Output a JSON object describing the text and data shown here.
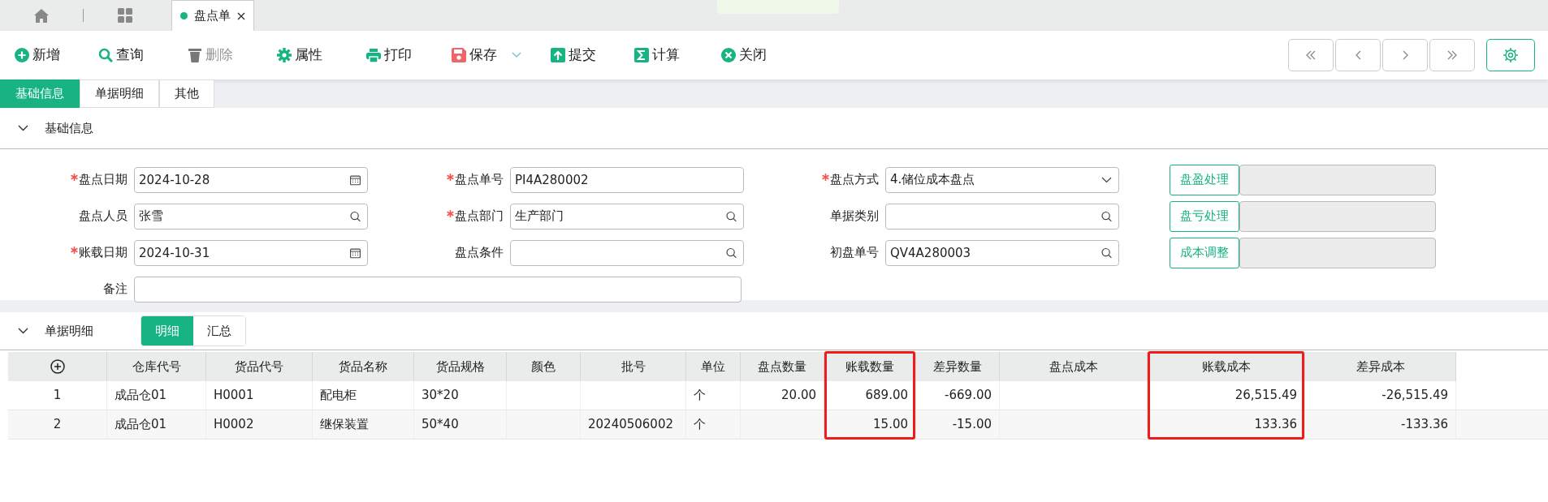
{
  "doc_tabs": [
    {
      "label": "盘点单",
      "selected": true
    }
  ],
  "toolbar": [
    {
      "label": "新增",
      "kind": "plus",
      "disabled": false,
      "dropdown": false
    },
    {
      "label": "查询",
      "kind": "search",
      "disabled": false,
      "dropdown": false
    },
    {
      "label": "删除",
      "kind": "trash",
      "disabled": true,
      "dropdown": false
    },
    {
      "label": "属性",
      "kind": "gear",
      "disabled": false,
      "dropdown": false
    },
    {
      "label": "打印",
      "kind": "print",
      "disabled": false,
      "dropdown": false
    },
    {
      "label": "保存",
      "kind": "save",
      "disabled": false,
      "dropdown": true
    },
    {
      "label": "提交",
      "kind": "submit",
      "disabled": false,
      "dropdown": false
    },
    {
      "label": "计算",
      "kind": "sigma",
      "disabled": false,
      "dropdown": false
    },
    {
      "label": "关闭",
      "kind": "close",
      "disabled": false,
      "dropdown": false
    }
  ],
  "nav_buttons": [
    {
      "kind": "first"
    },
    {
      "kind": "prev"
    },
    {
      "kind": "next"
    },
    {
      "kind": "last"
    }
  ],
  "section_tabs": [
    {
      "label": "基础信息",
      "selected": true
    },
    {
      "label": "单据明细",
      "selected": false
    },
    {
      "label": "其他",
      "selected": false
    }
  ],
  "basic_section": {
    "title": "基础信息",
    "expanded": true,
    "rows": [
      [
        {
          "label": "盘点日期",
          "required": true,
          "kind": "date",
          "value": "2024-10-28"
        },
        {
          "label": "盘点单号",
          "required": true,
          "kind": "text",
          "value": "PI4A280002"
        },
        {
          "label": "盘点方式",
          "required": true,
          "kind": "select",
          "value": "4.储位成本盘点"
        }
      ],
      [
        {
          "label": "盘点人员",
          "required": false,
          "kind": "lookup",
          "value": "张雪"
        },
        {
          "label": "盘点部门",
          "required": true,
          "kind": "lookup",
          "value": "生产部门"
        },
        {
          "label": "单据类别",
          "required": false,
          "kind": "lookup"
        }
      ],
      [
        {
          "label": "账载日期",
          "required": true,
          "kind": "date",
          "value": "2024-10-31"
        },
        {
          "label": "盘点条件",
          "required": false,
          "kind": "lookup"
        },
        {
          "label": "初盘单号",
          "required": false,
          "kind": "lookup",
          "value": "QV4A280003"
        }
      ],
      [
        {
          "label": "备注",
          "required": false,
          "kind": "text"
        }
      ]
    ],
    "actions": [
      {
        "label": "盘盈处理"
      },
      {
        "label": "盘亏处理"
      },
      {
        "label": "成本调整"
      }
    ]
  },
  "detail_section": {
    "title": "单据明细",
    "expanded": true,
    "views": [
      {
        "label": "明细",
        "selected": true
      },
      {
        "label": "汇总",
        "selected": false
      }
    ],
    "table": {
      "columns": [
        {
          "kind": "add",
          "highlighted": false
        },
        {
          "label": "仓库代号",
          "kind": "text",
          "highlighted": false
        },
        {
          "label": "货品代号",
          "kind": "text",
          "highlighted": false
        },
        {
          "label": "货品名称",
          "kind": "text",
          "highlighted": false
        },
        {
          "label": "货品规格",
          "kind": "text",
          "highlighted": false
        },
        {
          "label": "颜色",
          "kind": "text",
          "highlighted": false
        },
        {
          "label": "批号",
          "kind": "text",
          "highlighted": false
        },
        {
          "label": "单位",
          "kind": "text",
          "highlighted": false
        },
        {
          "label": "盘点数量",
          "kind": "number",
          "highlighted": false
        },
        {
          "label": "账载数量",
          "kind": "number",
          "highlighted": true
        },
        {
          "label": "差异数量",
          "kind": "number",
          "highlighted": false
        },
        {
          "label": "盘点成本",
          "kind": "number",
          "highlighted": false
        },
        {
          "label": "账载成本",
          "kind": "number",
          "highlighted": true
        },
        {
          "label": "差异成本",
          "kind": "number",
          "highlighted": false
        }
      ],
      "rows": [
        [
          "1",
          "成品仓01",
          "H0001",
          "配电柜",
          "30*20",
          null,
          null,
          "个",
          "20.00",
          "689.00",
          "-669.00",
          null,
          "26,515.49",
          "-26,515.49"
        ],
        [
          "2",
          "成品仓01",
          "H0002",
          "继保装置",
          "50*40",
          null,
          "20240506002",
          "个",
          null,
          "15.00",
          "-15.00",
          null,
          "133.36",
          "-133.36"
        ]
      ]
    }
  }
}
